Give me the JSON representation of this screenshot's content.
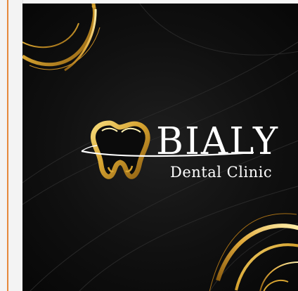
{
  "brand": {
    "name": "BIALY",
    "tagline": "Dental Clinic",
    "logo_icon": "tooth-icon"
  },
  "colors": {
    "background": "#0b0b0b",
    "gold": "#d7a431",
    "text": "#ffffff",
    "accent_line": "#e6883b"
  }
}
